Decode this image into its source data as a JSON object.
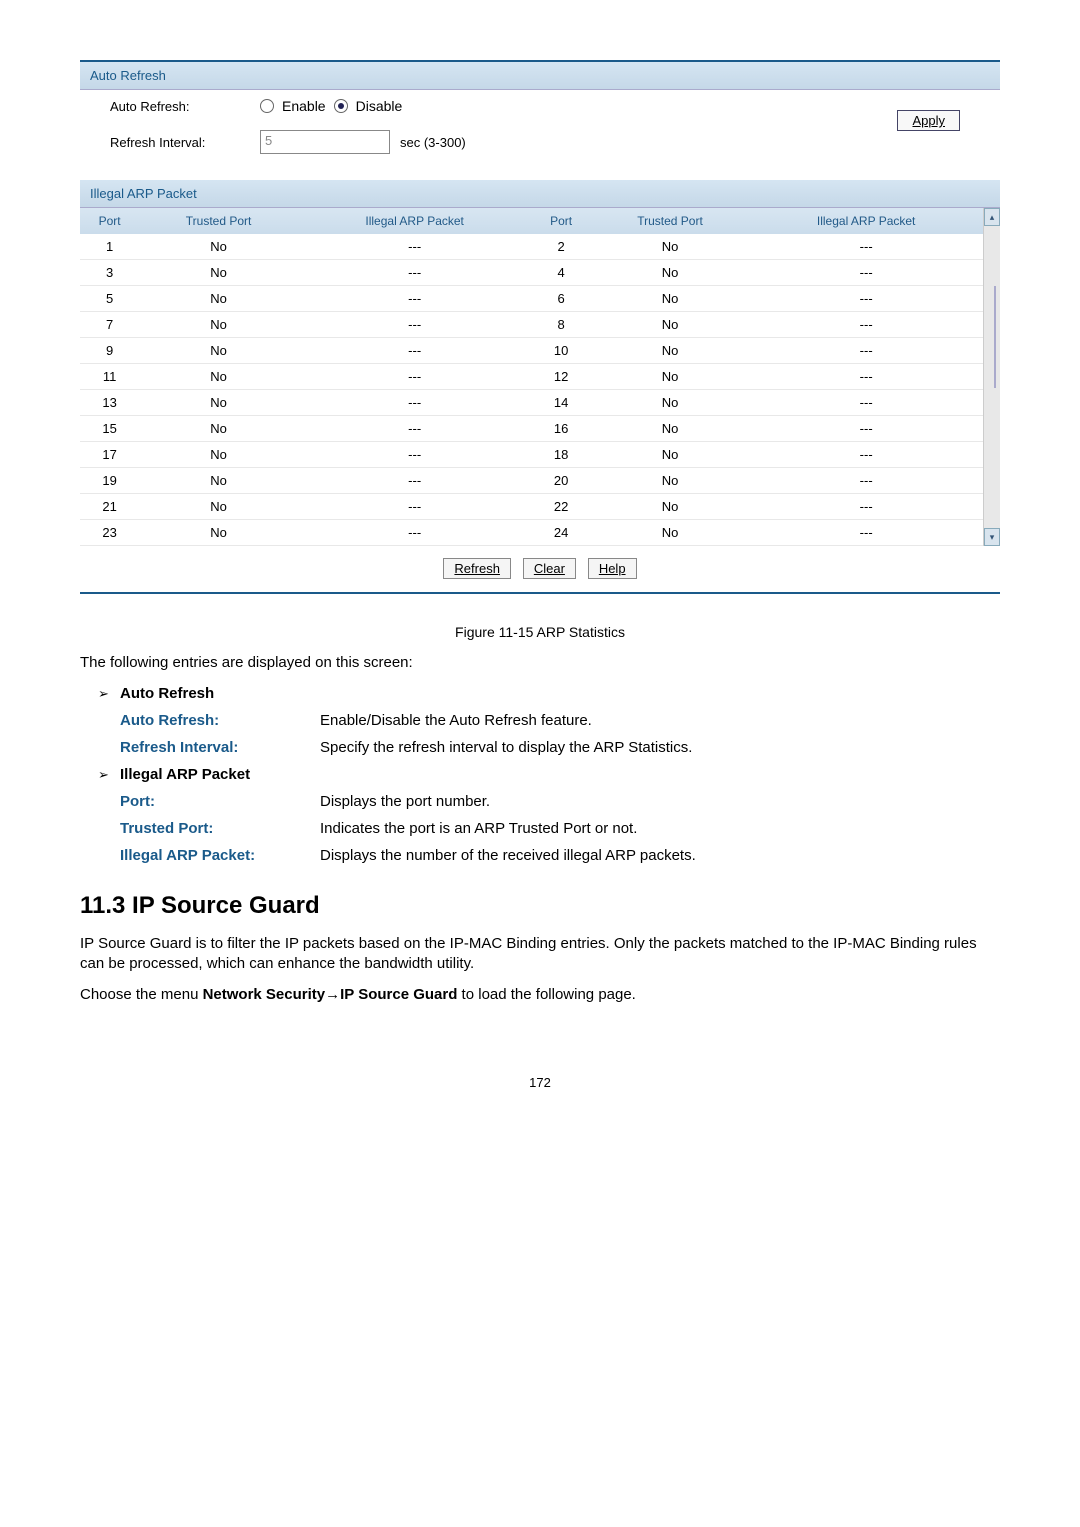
{
  "panel": {
    "autoRefreshHeader": "Auto Refresh",
    "autoRefreshLabel": "Auto Refresh:",
    "enableLabel": "Enable",
    "disableLabel": "Disable",
    "refreshIntervalLabel": "Refresh Interval:",
    "refreshIntervalValue": "5",
    "secRange": "sec (3-300)",
    "applyLabel": "Apply",
    "illegalHeader": "Illegal ARP Packet",
    "columns": {
      "port": "Port",
      "trusted": "Trusted Port",
      "illegal": "Illegal ARP Packet",
      "port2": "Port",
      "trusted2": "Trusted Port",
      "illegal2": "Illegal ARP Packet"
    },
    "rows": [
      {
        "p1": "1",
        "t1": "No",
        "i1": "---",
        "p2": "2",
        "t2": "No",
        "i2": "---"
      },
      {
        "p1": "3",
        "t1": "No",
        "i1": "---",
        "p2": "4",
        "t2": "No",
        "i2": "---"
      },
      {
        "p1": "5",
        "t1": "No",
        "i1": "---",
        "p2": "6",
        "t2": "No",
        "i2": "---"
      },
      {
        "p1": "7",
        "t1": "No",
        "i1": "---",
        "p2": "8",
        "t2": "No",
        "i2": "---"
      },
      {
        "p1": "9",
        "t1": "No",
        "i1": "---",
        "p2": "10",
        "t2": "No",
        "i2": "---"
      },
      {
        "p1": "11",
        "t1": "No",
        "i1": "---",
        "p2": "12",
        "t2": "No",
        "i2": "---"
      },
      {
        "p1": "13",
        "t1": "No",
        "i1": "---",
        "p2": "14",
        "t2": "No",
        "i2": "---"
      },
      {
        "p1": "15",
        "t1": "No",
        "i1": "---",
        "p2": "16",
        "t2": "No",
        "i2": "---"
      },
      {
        "p1": "17",
        "t1": "No",
        "i1": "---",
        "p2": "18",
        "t2": "No",
        "i2": "---"
      },
      {
        "p1": "19",
        "t1": "No",
        "i1": "---",
        "p2": "20",
        "t2": "No",
        "i2": "---"
      },
      {
        "p1": "21",
        "t1": "No",
        "i1": "---",
        "p2": "22",
        "t2": "No",
        "i2": "---"
      },
      {
        "p1": "23",
        "t1": "No",
        "i1": "---",
        "p2": "24",
        "t2": "No",
        "i2": "---"
      }
    ],
    "refreshBtn": "Refresh",
    "clearBtn": "Clear",
    "helpBtn": "Help"
  },
  "figureCaption": "Figure 11-15 ARP Statistics",
  "introLine": "The following entries are displayed on this screen:",
  "bullets": {
    "b1": "Auto Refresh",
    "b2": "Illegal ARP Packet"
  },
  "defs": {
    "autoRefresh": {
      "term": "Auto Refresh:",
      "desc": "Enable/Disable the Auto Refresh feature."
    },
    "refreshInterval": {
      "term": "Refresh Interval:",
      "desc": "Specify the refresh interval to display the ARP Statistics."
    },
    "port": {
      "term": "Port:",
      "desc": "Displays the port number."
    },
    "trusted": {
      "term": "Trusted Port:",
      "desc": "Indicates the port is an ARP Trusted Port or not."
    },
    "illegal": {
      "term": "Illegal ARP Packet:",
      "desc": "Displays the number of the received illegal ARP packets."
    }
  },
  "sectionTitle": "11.3 IP Source Guard",
  "para1": "IP Source Guard is to filter the IP packets based on the IP-MAC Binding entries. Only the packets matched to the IP-MAC Binding rules can be processed, which can enhance the bandwidth utility.",
  "para2_pre": "Choose the menu ",
  "para2_bold": "Network Security→IP Source Guard",
  "para2_post": " to load the following page.",
  "pageNumber": "172"
}
